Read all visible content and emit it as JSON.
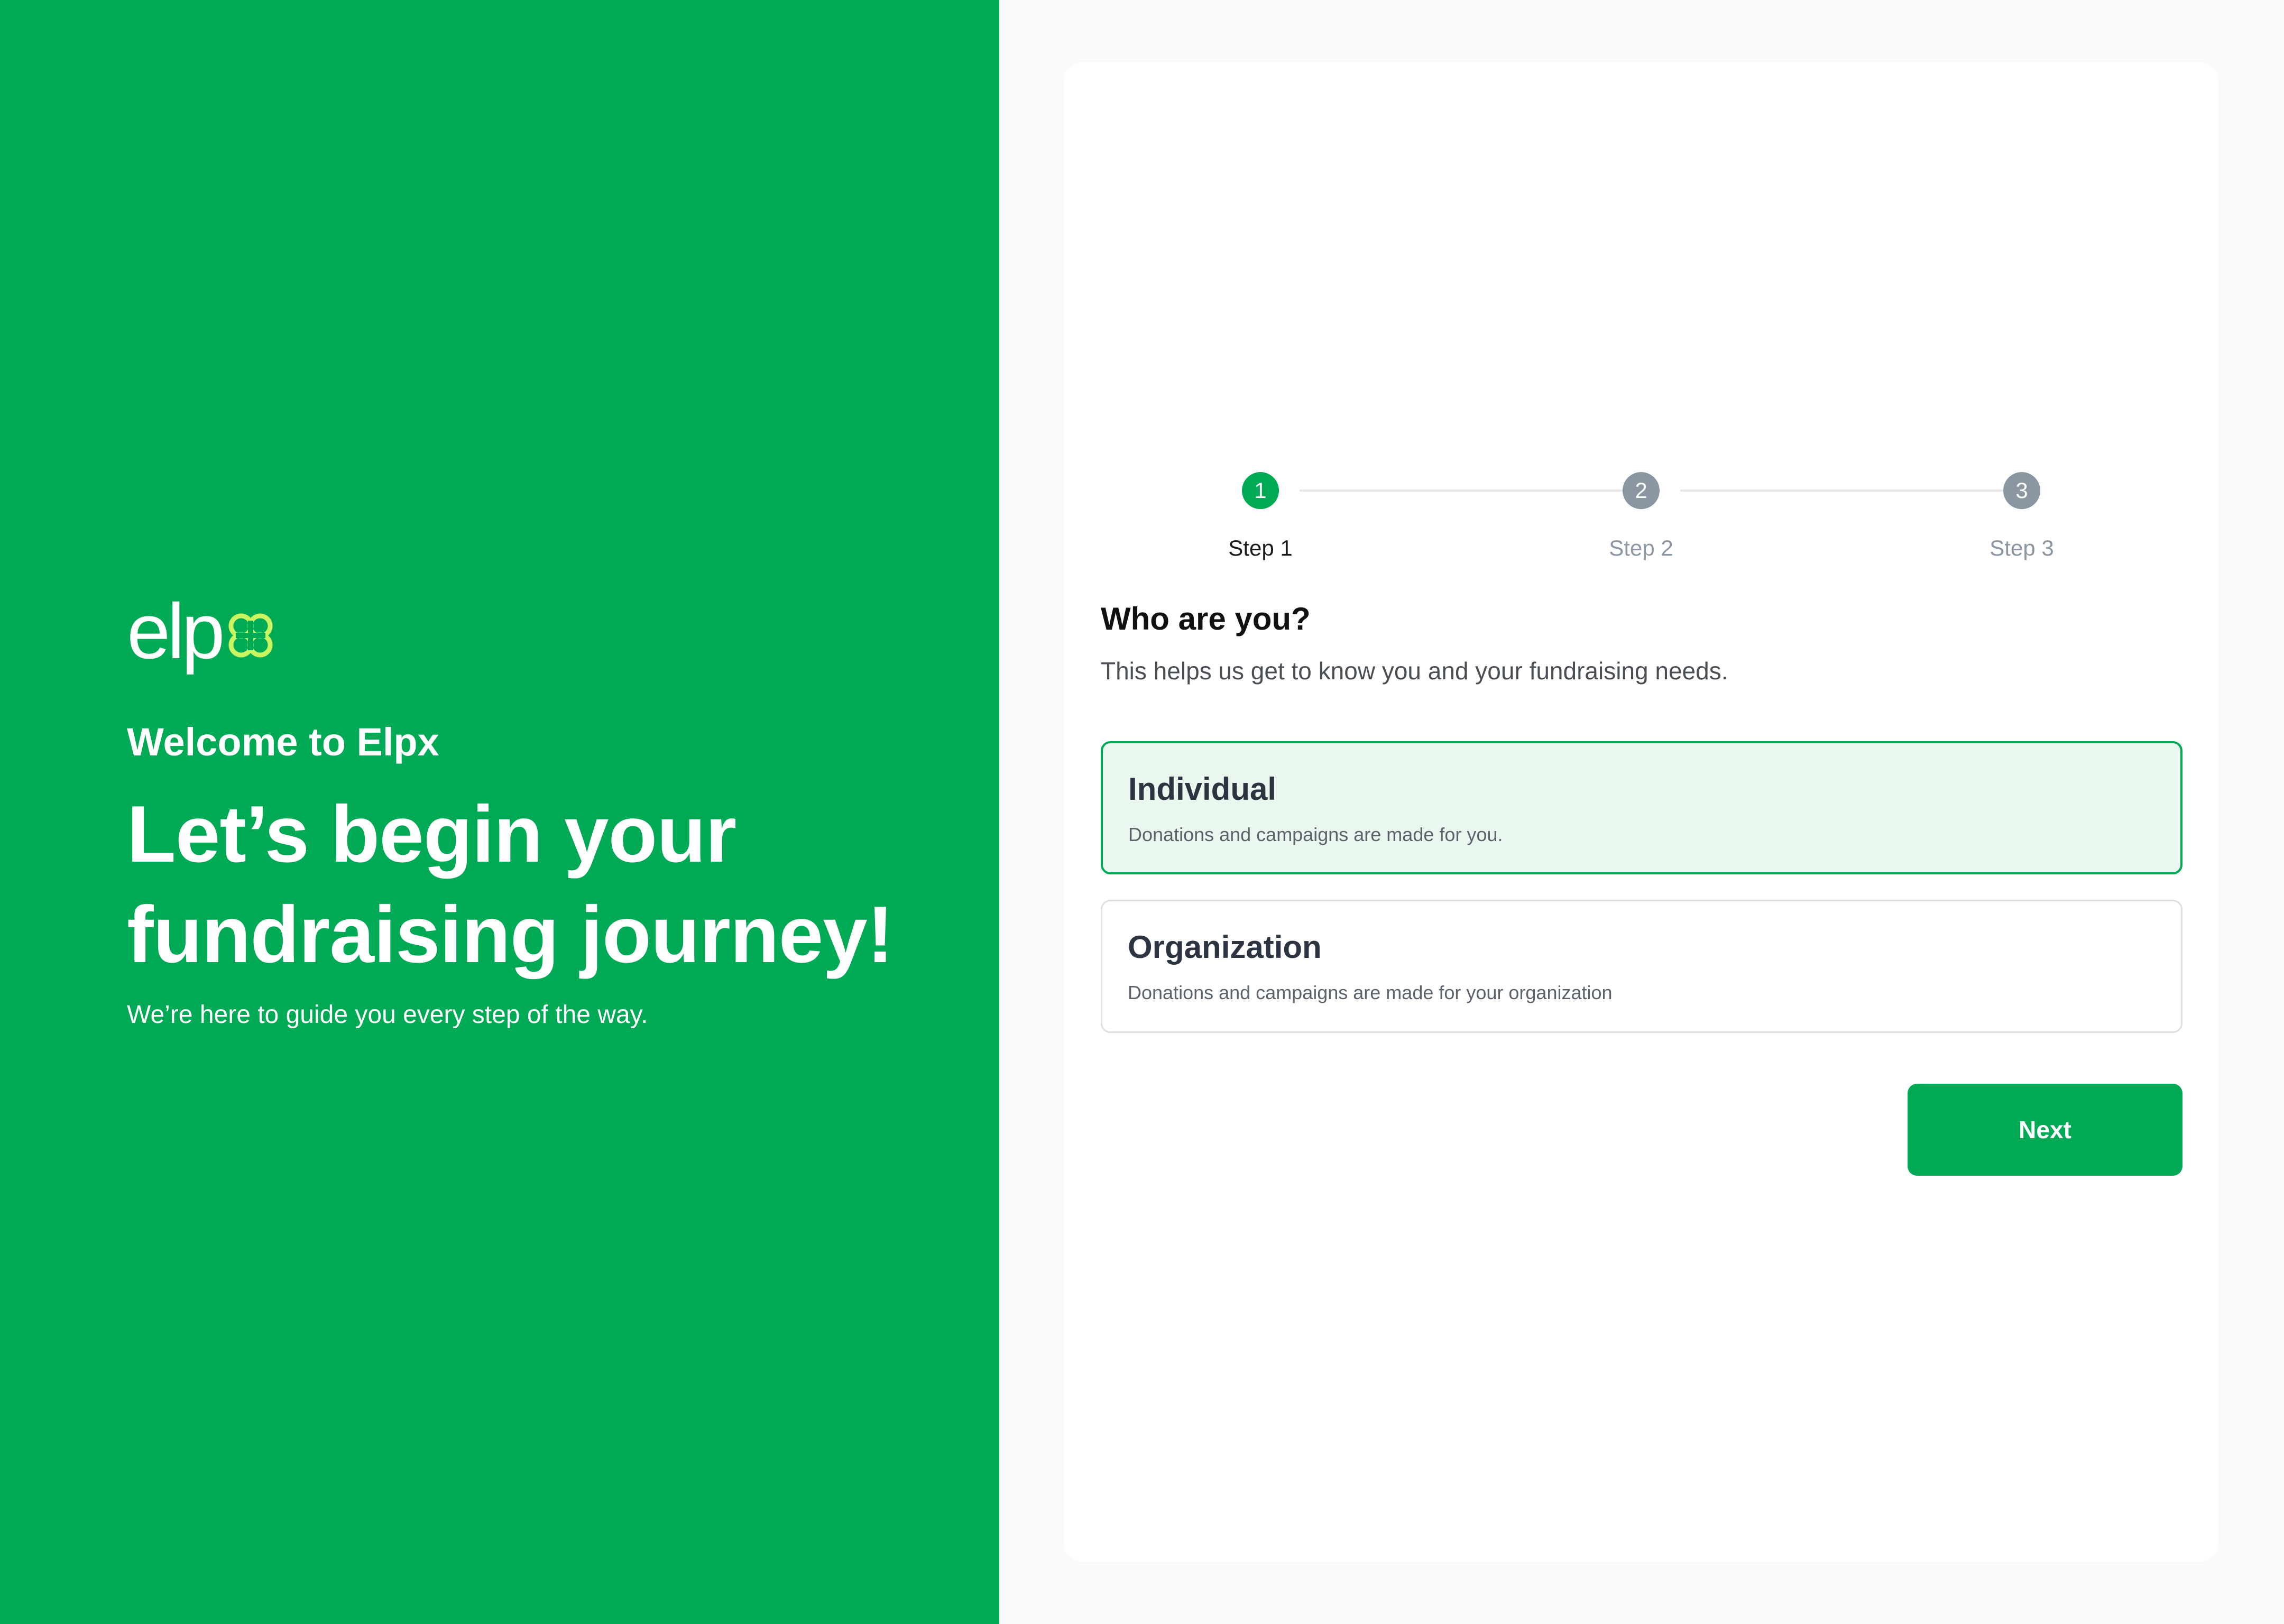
{
  "colors": {
    "brand_green": "#00aa55",
    "logo_accent": "#c8f560",
    "inactive_step": "#8c96a3",
    "selected_bg": "#eaf7ef"
  },
  "brand": {
    "logo_text": "elp",
    "logo_icon": "clover-x-icon"
  },
  "hero": {
    "welcome": "Welcome to Elpx",
    "headline_line1": "Let’s begin your",
    "headline_line2": "fundraising journey!",
    "tagline": "We’re here to guide you every step of the way."
  },
  "stepper": {
    "steps": [
      {
        "number": "1",
        "label": "Step 1",
        "active": true
      },
      {
        "number": "2",
        "label": "Step 2",
        "active": false
      },
      {
        "number": "3",
        "label": "Step 3",
        "active": false
      }
    ]
  },
  "form": {
    "question": "Who are you?",
    "subtext": "This helps us get to know you and your fundraising needs.",
    "options": [
      {
        "title": "Individual",
        "description": "Donations and campaigns are made for you.",
        "selected": true
      },
      {
        "title": "Organization",
        "description": "Donations and campaigns are made for your organization",
        "selected": false
      }
    ],
    "next_label": "Next"
  }
}
